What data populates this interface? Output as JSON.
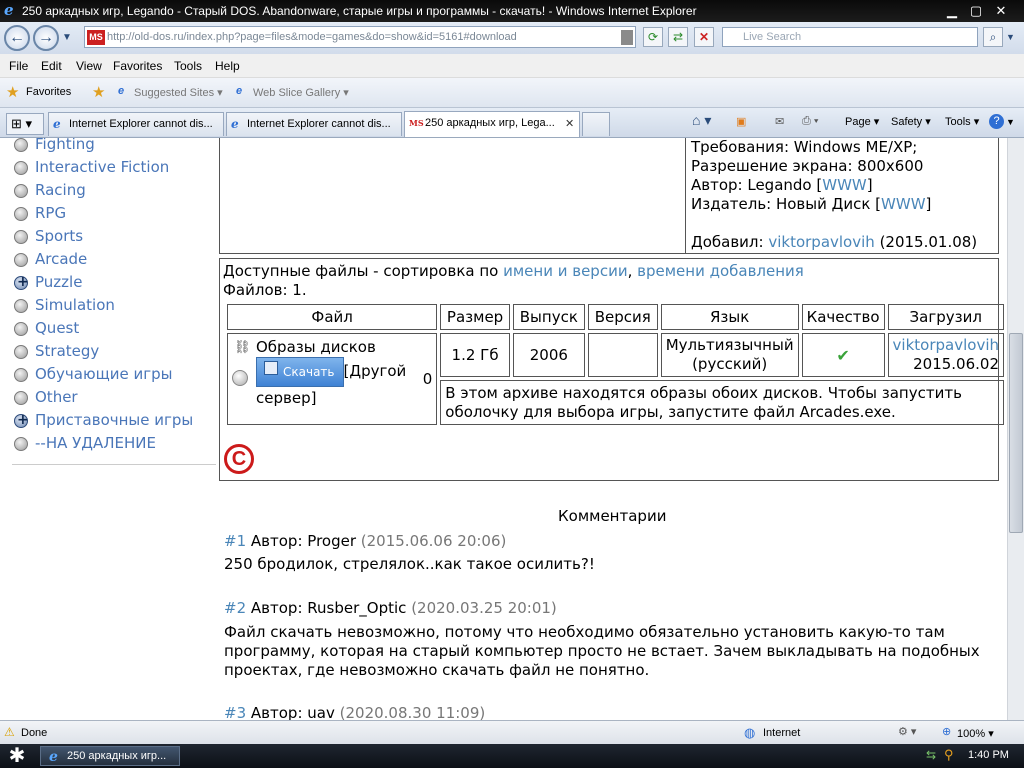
{
  "window": {
    "title": "250 аркадных игр, Legando - Старый DOS. Abandonware, старые игры и программы - скачать! - Windows Internet Explorer"
  },
  "nav": {
    "address": "http://old-dos.ru/index.php?page=files&mode=games&do=show&id=5161#download",
    "favicon": "MS",
    "search_placeholder": "Live Search"
  },
  "menu": {
    "file": "File",
    "edit": "Edit",
    "view": "View",
    "favorites": "Favorites",
    "tools": "Tools",
    "help": "Help"
  },
  "favbar": {
    "favorites": "Favorites",
    "suggested": "Suggested Sites ▾",
    "webslice": "Web Slice Gallery ▾"
  },
  "tabs": [
    {
      "label": "Internet Explorer cannot dis..."
    },
    {
      "label": "Internet Explorer cannot dis..."
    },
    {
      "label": "250 аркадных игр, Lega..."
    }
  ],
  "commandbar": {
    "page": "Page ▾",
    "safety": "Safety ▾",
    "tools": "Tools ▾"
  },
  "sidebar": {
    "genres": [
      {
        "label": "Fighting",
        "plus": false
      },
      {
        "label": "Interactive Fiction",
        "plus": false
      },
      {
        "label": "Racing",
        "plus": false
      },
      {
        "label": "RPG",
        "plus": false
      },
      {
        "label": "Sports",
        "plus": false
      },
      {
        "label": "Arcade",
        "plus": false
      },
      {
        "label": "Puzzle",
        "plus": true
      },
      {
        "label": "Simulation",
        "plus": false
      },
      {
        "label": "Quest",
        "plus": false
      },
      {
        "label": "Strategy",
        "plus": false
      },
      {
        "label": "Обучающие игры",
        "plus": false
      },
      {
        "label": "Other",
        "plus": false
      },
      {
        "label": "Приставочные игры",
        "plus": true
      },
      {
        "label": "--НА УДАЛЕНИЕ",
        "plus": false
      }
    ]
  },
  "info": {
    "requirements": "Требования: Windows ME/XP;",
    "resolution": "Разрешение экрана: 800x600",
    "author_label": "Автор: Legando [",
    "author_link": "WWW",
    "publisher_label": "Издатель: Новый Диск [",
    "publisher_link": "WWW",
    "bracket_close": "]",
    "added_label": "Добавил: ",
    "added_user": "viktorpavlovih",
    "added_date": " (2015.01.08)"
  },
  "files": {
    "sort_prefix": "Доступные файлы - сортировка по ",
    "sort_name": "имени и версии",
    "sort_sep": ", ",
    "sort_time": "времени добавления",
    "count": "Файлов: 1.",
    "headers": {
      "file": "Файл",
      "size": "Размер",
      "year": "Выпуск",
      "version": "Версия",
      "lang": "Язык",
      "quality": "Качество",
      "uploader": "Загрузил"
    },
    "row": {
      "name": "Образы дисков",
      "download": "Скачать",
      "other_server": "[Другой сервер]",
      "downloads": "0",
      "size": "1.2 Гб",
      "year": "2006",
      "version": "",
      "lang": "Мультиязычный (русский)",
      "quality": "✔",
      "uploader": "viktorpavlovih",
      "upload_date": "2015.06.02",
      "description": "В этом архиве находятся образы обоих дисков. Чтобы запустить оболочку для выбора игры, запустите файл Arcades.exe."
    }
  },
  "comments": {
    "heading": "Комментарии",
    "items": [
      {
        "num": "#1",
        "author_label": "Автор: ",
        "author": "Proger",
        "date": "(2015.06.06 20:06)",
        "text": "250 бродилок, стрелялок..как такое осилить?!"
      },
      {
        "num": "#2",
        "author_label": "Автор: ",
        "author": "Rusber_Optic",
        "date": "(2020.03.25 20:01)",
        "text": "Файл скачать невозможно, потому что необходимо обязательно установить какую-то там программу, которая на старый компьютер просто не встает. Зачем выкладывать на подобных проектах, где невозможно скачать файл не понятно."
      },
      {
        "num": "#3",
        "author_label": "Автор: ",
        "author": "uav",
        "date": "(2020.08.30 11:09)",
        "text": ""
      }
    ]
  },
  "status": {
    "text": "Done",
    "zone": "Internet",
    "zoom": "100% ▾"
  },
  "taskbar": {
    "item": "250 аркадных игр...",
    "clock": "1:40 PM"
  },
  "colors": {
    "link": "#4a86b8",
    "check": "#3aa33a"
  }
}
